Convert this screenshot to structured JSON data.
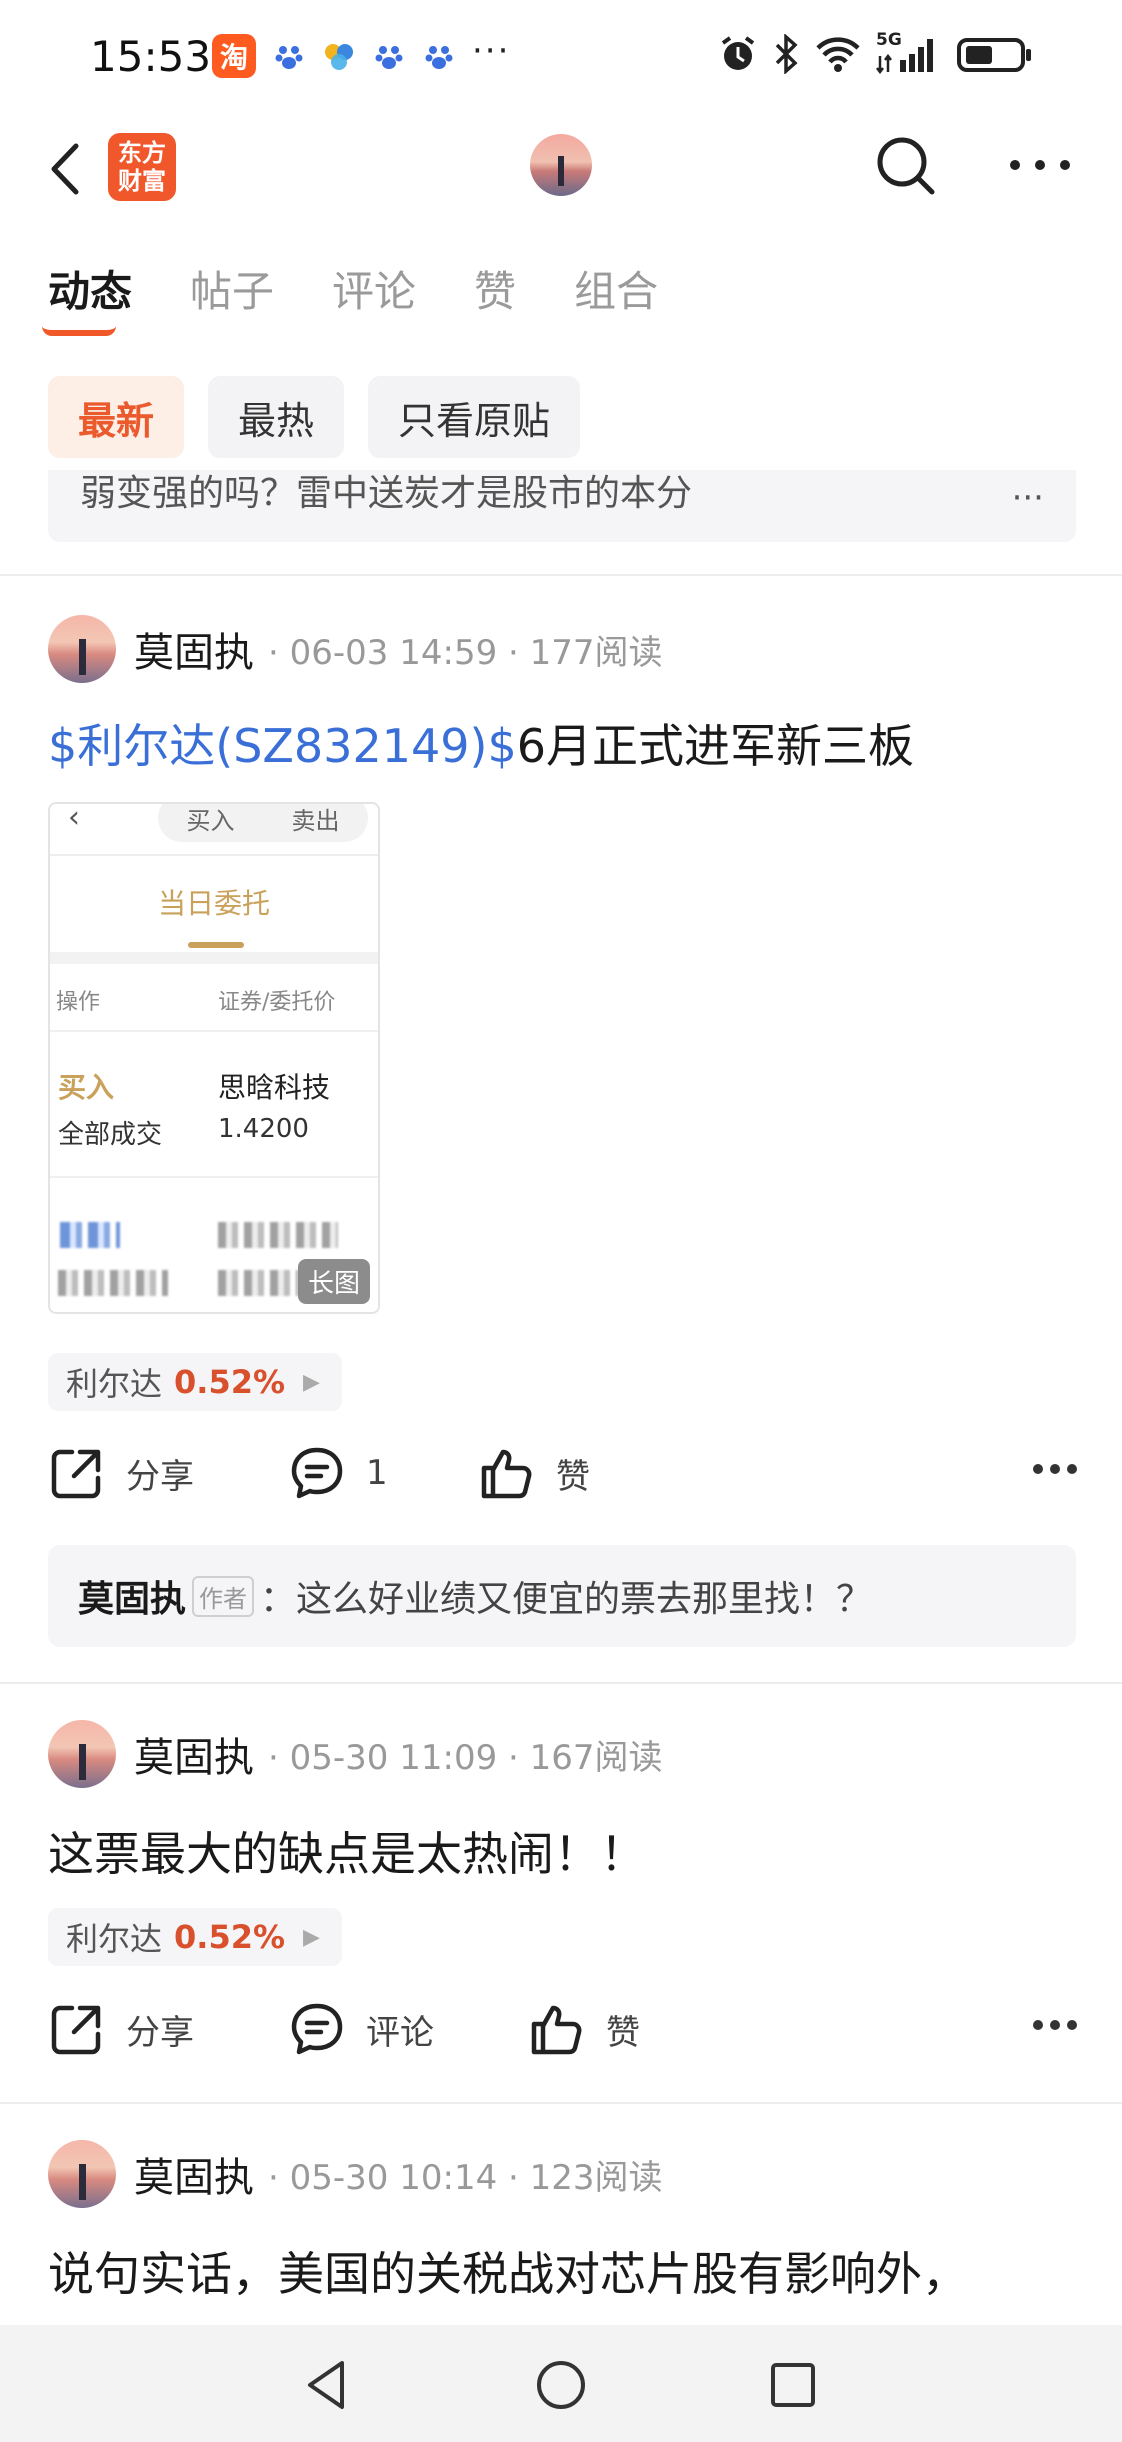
{
  "status_bar": {
    "time": "15:53",
    "taobao_label": "淘",
    "more": "···",
    "network": "5G"
  },
  "navbar": {
    "brand_logo": "东方\n财富"
  },
  "tabs": [
    "动态",
    "帖子",
    "评论",
    "赞",
    "组合"
  ],
  "filters": [
    "最新",
    "最热",
    "只看原贴"
  ],
  "prev_reply": {
    "text": "弱变强的吗？雷中送炭才是股市的本分",
    "more": "···"
  },
  "posts": [
    {
      "author": "莫固执",
      "meta": "· 06-03 14:59 · 177阅读",
      "title_link": "$利尔达(SZ832149)$",
      "title_rest": "6月正式进军新三板",
      "thumb": {
        "seg_buy": "买入",
        "seg_sell": "卖出",
        "title": "当日委托",
        "col_op": "操作",
        "col_sec": "证券/委托价",
        "buy": "买入",
        "status": "全部成交",
        "name": "思晗科技",
        "price": "1.4200",
        "long_image": "长图"
      },
      "stock_name": "利尔达",
      "stock_pct": "0.52%",
      "share": "分享",
      "comments": "1",
      "like": "赞",
      "reply": {
        "author": "莫固执",
        "badge": "作者",
        "sep": "：",
        "text": "这么好业绩又便宜的票去那里找！？"
      }
    },
    {
      "author": "莫固执",
      "meta": "· 05-30 11:09 · 167阅读",
      "title": "这票最大的缺点是太热闹！！",
      "stock_name": "利尔达",
      "stock_pct": "0.52%",
      "share": "分享",
      "comments": "评论",
      "like": "赞"
    },
    {
      "author": "莫固执",
      "meta": "· 05-30 10:14 · 123阅读",
      "title": "说句实话，美国的关税战对芯片股有影响外，"
    }
  ],
  "colors": {
    "accent": "#f0582a",
    "stock_link": "#3a6fd8",
    "up": "#d9512c"
  }
}
